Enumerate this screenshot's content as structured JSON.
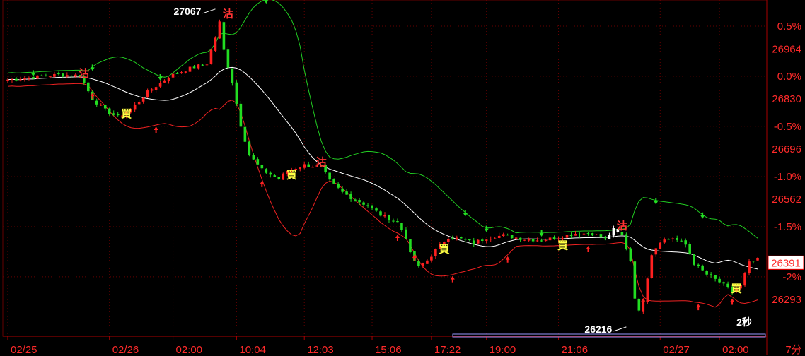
{
  "chart_data": {
    "type": "candlestick",
    "y_axis": {
      "percent_labels": [
        {
          "text": "0.5%",
          "price": 27025
        },
        {
          "text": "0.0%",
          "price": 26891
        },
        {
          "text": "-0.5%",
          "price": 26757
        },
        {
          "text": "-1.0%",
          "price": 26622
        },
        {
          "text": "-1.5%",
          "price": 26488
        },
        {
          "text": "-2%",
          "price": 26354
        }
      ],
      "price_labels": [
        {
          "text": "26964",
          "price": 26964
        },
        {
          "text": "26830",
          "price": 26830
        },
        {
          "text": "26696",
          "price": 26696
        },
        {
          "text": "26562",
          "price": 26562
        },
        {
          "text": "26293",
          "price": 26293
        }
      ],
      "range": [
        26195,
        27095
      ],
      "current_price": "26391"
    },
    "x_axis": {
      "labels": [
        {
          "text": "02/25",
          "index": 0
        },
        {
          "text": "02/26",
          "index": 24
        },
        {
          "text": "02:00",
          "index": 39
        },
        {
          "text": "10:04",
          "index": 54
        },
        {
          "text": "12:03",
          "index": 70
        },
        {
          "text": "15:06",
          "index": 86
        },
        {
          "text": "17:22",
          "index": 100
        },
        {
          "text": "19:00",
          "index": 113
        },
        {
          "text": "21:06",
          "index": 130
        },
        {
          "text": "02/27",
          "index": 154
        },
        {
          "text": "02:00",
          "index": 168
        }
      ],
      "period": "7分"
    },
    "timer": "2秒",
    "annotations": [
      {
        "text": "27067",
        "index": 49,
        "price": 27067,
        "side": "left"
      },
      {
        "text": "26216",
        "index": 146,
        "price": 26216,
        "side": "left"
      }
    ],
    "signals": [
      {
        "text": "買",
        "index": 28,
        "price": 26790
      },
      {
        "text": "買",
        "index": 67,
        "price": 26626
      },
      {
        "text": "買",
        "index": 103,
        "price": 26428
      },
      {
        "text": "買",
        "index": 131,
        "price": 26437
      },
      {
        "text": "買",
        "index": 172,
        "price": 26322
      },
      {
        "text": "沽",
        "index": 18,
        "price": 26897
      },
      {
        "text": "沽",
        "index": 52,
        "price": 27057
      },
      {
        "text": "沽",
        "index": 74,
        "price": 26660
      },
      {
        "text": "沽",
        "index": 145,
        "price": 26490
      }
    ],
    "colors": {
      "up": "#ff2020",
      "down": "#22dd22",
      "doji": "#ffffff",
      "upper_band": "#22cc22",
      "middle_band": "#ffffff",
      "lower_band": "#ee2222",
      "axis": "#ff2a2a",
      "grid": "#660000",
      "buy_arrow": "#ff2222",
      "sell_arrow": "#22dd22"
    },
    "grid": true
  }
}
